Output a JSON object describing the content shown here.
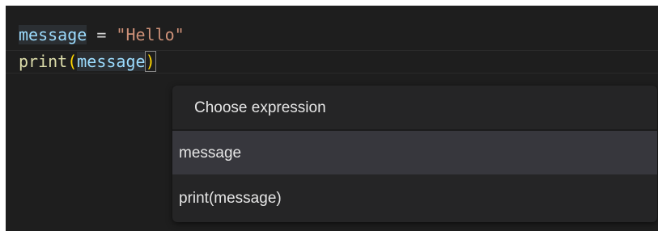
{
  "editor": {
    "line1": {
      "var": "message",
      "op": " = ",
      "str": "\"Hello\""
    },
    "line2": {
      "fn": "print",
      "open": "(",
      "arg": "message",
      "close": ")"
    }
  },
  "popup": {
    "title": "Choose expression",
    "items": [
      {
        "label": "message",
        "selected": true
      },
      {
        "label": "print(message)",
        "selected": false
      }
    ]
  },
  "colors": {
    "editor_background": "#1e1e1e",
    "popup_background": "#252526",
    "selected_item_background": "#37373d",
    "variable": "#9cdcfe",
    "string": "#ce9178",
    "function": "#dcdcaa",
    "bracket": "#ffd700"
  }
}
